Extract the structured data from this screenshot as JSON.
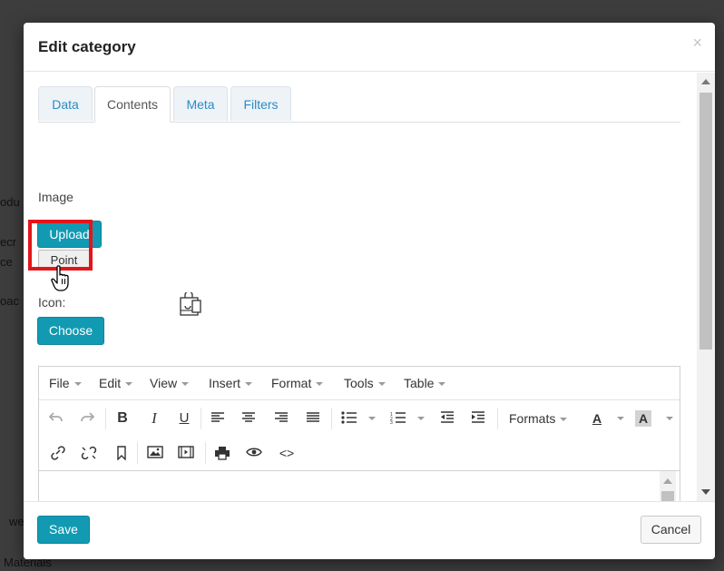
{
  "background": {
    "fragments": [
      "odu",
      "ecr",
      "ce",
      "oac",
      "we",
      "Materials"
    ]
  },
  "modal": {
    "title": "Edit category",
    "close_symbol": "×"
  },
  "tabs": [
    {
      "label": "Data",
      "active": false
    },
    {
      "label": "Contents",
      "active": true
    },
    {
      "label": "Meta",
      "active": false
    },
    {
      "label": "Filters",
      "active": false
    }
  ],
  "image_section": {
    "label": "Image",
    "upload_label": "Upload",
    "point_label": "Point"
  },
  "icon_section": {
    "label": "Icon:",
    "choose_label": "Choose"
  },
  "editor": {
    "menu": [
      "File",
      "Edit",
      "View",
      "Insert",
      "Format",
      "Tools",
      "Table"
    ],
    "formats_label": "Formats",
    "bold_glyph": "B",
    "italic_glyph": "I",
    "underline_glyph": "U",
    "text_color_glyph": "A",
    "bg_color_glyph": "A",
    "code_glyph": "<>"
  },
  "footer": {
    "save_label": "Save",
    "cancel_label": "Cancel"
  },
  "colors": {
    "accent": "#129ab2",
    "link": "#2a8cc4",
    "highlight": "#e3151a",
    "overlay": "#3d3d3d"
  }
}
